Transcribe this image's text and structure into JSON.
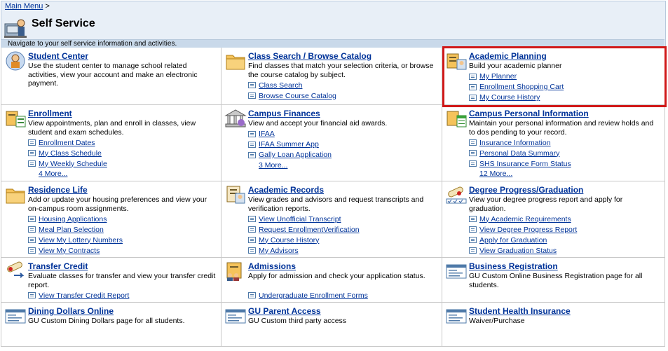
{
  "breadcrumb": {
    "main_menu": "Main Menu",
    "separator": ">"
  },
  "page_title": "Self Service",
  "nav_hint": "Navigate to your self service information and activities.",
  "colors": {
    "link": "#003399",
    "header_bg": "#e8eff7",
    "highlight": "#d01818"
  },
  "cells": [
    {
      "title": "Student Center",
      "icon": "student-center-icon",
      "desc": "Use the student center to manage school related activities, view your account and make an electronic payment.",
      "links": [],
      "more": ""
    },
    {
      "title": "Class Search / Browse Catalog",
      "icon": "folder-icon",
      "desc": "Find classes that match your selection criteria, or browse the course catalog by subject.",
      "links": [
        "Class Search",
        "Browse Course Catalog"
      ],
      "more": ""
    },
    {
      "title": "Academic Planning",
      "icon": "academic-planning-icon",
      "desc": "Build your academic planner",
      "links": [
        "My Planner",
        "Enrollment Shopping Cart",
        "My Course History"
      ],
      "more": ""
    },
    {
      "title": "Enrollment",
      "icon": "enrollment-icon",
      "desc": "View appointments, plan and enroll in classes, view student and exam schedules.",
      "links": [
        "Enrollment Dates",
        "My Class Schedule",
        "My Weekly Schedule"
      ],
      "more": "4 More..."
    },
    {
      "title": "Campus Finances",
      "icon": "campus-finances-icon",
      "desc": "View and accept your financial aid awards.",
      "links": [
        "IFAA",
        "IFAA Summer App",
        "Gally Loan Application"
      ],
      "more": "3 More..."
    },
    {
      "title": "Campus Personal Information",
      "icon": "personal-information-icon",
      "desc": "Maintain your personal information and review holds and to dos pending to your record.",
      "links": [
        "Insurance Information",
        "Personal Data Summary",
        "SHS Insurance Form Status"
      ],
      "more": "12 More..."
    },
    {
      "title": "Residence Life",
      "icon": "folder-icon",
      "desc": "Add or update your housing preferences and view your on-campus room assignments.",
      "links": [
        "Housing Applications",
        "Meal Plan Selection",
        "View My Lottery Numbers",
        "View My Contracts"
      ],
      "more": ""
    },
    {
      "title": "Academic Records",
      "icon": "academic-records-icon",
      "desc": "View grades and advisors and request transcripts and verification reports.",
      "links": [
        "View Unofficial Transcript",
        "Request EnrollmentVerification",
        "My Course History",
        "My Advisors"
      ],
      "more": ""
    },
    {
      "title": "Degree Progress/Graduation",
      "icon": "diploma-icon",
      "desc": "View your degree progress report and apply for graduation.",
      "links": [
        "My Academic Requirements",
        "View Degree Progress Report",
        "Apply for Graduation",
        "View Graduation Status"
      ],
      "more": ""
    },
    {
      "title": "Transfer Credit",
      "icon": "transfer-credit-icon",
      "desc": "Evaluate classes for transfer and view your transfer credit report.",
      "links": [
        "View Transfer Credit Report"
      ],
      "more": ""
    },
    {
      "title": "Admissions",
      "icon": "admissions-icon",
      "desc": "Apply for admission and check your application status.",
      "links": [
        "Undergraduate Enrollment Forms"
      ],
      "more": ""
    },
    {
      "title": "Business Registration",
      "icon": "page-icon",
      "desc": "GU Custom Online Business Registration page for all students.",
      "links": [],
      "more": ""
    },
    {
      "title": "Dining Dollars Online",
      "icon": "page-icon",
      "desc": "GU Custom Dining Dollars page for all students.",
      "links": [],
      "more": ""
    },
    {
      "title": "GU Parent Access",
      "icon": "page-icon",
      "desc": "GU Custom third party access",
      "links": [],
      "more": ""
    },
    {
      "title": "Student Health Insurance",
      "icon": "page-icon",
      "desc": "Waiver/Purchase",
      "links": [],
      "more": ""
    }
  ]
}
